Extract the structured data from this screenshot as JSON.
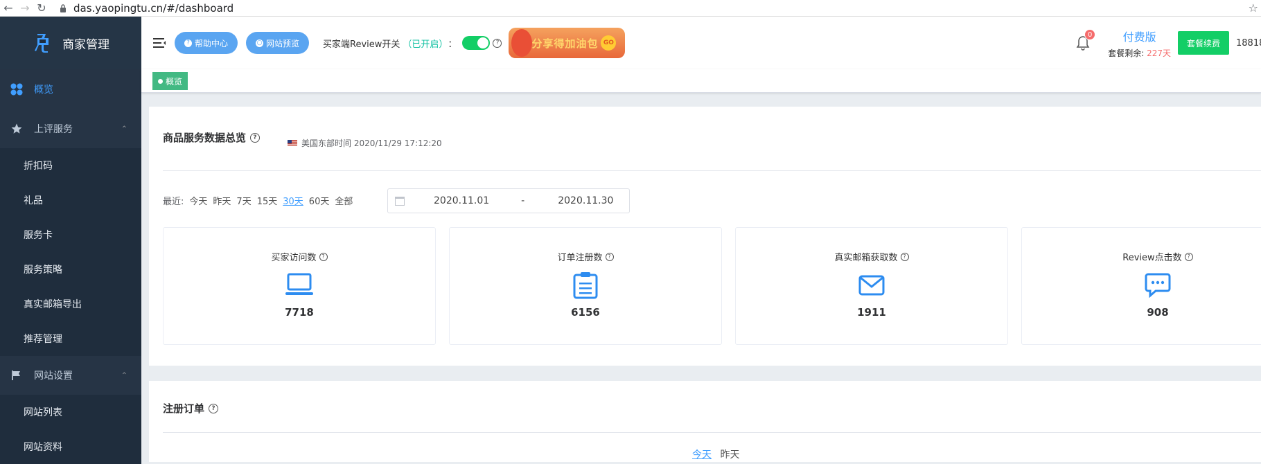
{
  "browser": {
    "url": "das.yaopingtu.cn/#/dashboard",
    "icons": [
      "back-arrow-icon",
      "forward-arrow-icon",
      "reload-icon",
      "lock-icon",
      "star-icon"
    ]
  },
  "sidebar": {
    "brand": "商家管理",
    "overview": "概览",
    "groups": [
      {
        "label": "上评服务",
        "icon": "star-icon",
        "items": [
          "折扣码",
          "礼品",
          "服务卡",
          "服务策略",
          "真实邮箱导出",
          "推荐管理"
        ]
      },
      {
        "label": "网站设置",
        "icon": "flag-icon",
        "items": [
          "网站列表",
          "网站资料"
        ]
      }
    ]
  },
  "header": {
    "help_center": "帮助中心",
    "site_preview": "网站预览",
    "review_switch_label": "买家端Review开关",
    "review_switch_state": "（已开启）",
    "review_switch_colon": "：",
    "promo_text": "分享得加油包",
    "promo_go": "GO",
    "notification_count": "0",
    "plan_name": "付费版",
    "plan_remaining_label": "套餐剩余:",
    "plan_remaining_value": "227天",
    "renew_button": "套餐续费",
    "account_phone": "18818"
  },
  "tags": {
    "active_tag": "概览"
  },
  "overview_card": {
    "title": "商品服务数据总览",
    "timezone_text": "美国东部时间 2020/11/29 17:12:20",
    "range_label": "最近:",
    "range_options": [
      "今天",
      "昨天",
      "7天",
      "15天",
      "30天",
      "60天",
      "全部"
    ],
    "range_selected": "30天",
    "date_start": "2020.11.01",
    "date_separator": "-",
    "date_end": "2020.11.30",
    "stats": [
      {
        "label": "买家访问数",
        "icon": "laptop-icon",
        "value": "7718"
      },
      {
        "label": "订单注册数",
        "icon": "clipboard-icon",
        "value": "6156"
      },
      {
        "label": "真实邮箱获取数",
        "icon": "mail-icon",
        "value": "1911"
      },
      {
        "label": "Review点击数",
        "icon": "chat-icon",
        "value": "908"
      }
    ]
  },
  "orders_card": {
    "title": "注册订单",
    "tabs": [
      "今天",
      "昨天"
    ]
  },
  "colors": {
    "sidebar_bg": "#1f2d3d",
    "accent_blue": "#409eff",
    "success_green": "#13ce66",
    "tag_green": "#42b983",
    "danger_red": "#f56c6c"
  }
}
